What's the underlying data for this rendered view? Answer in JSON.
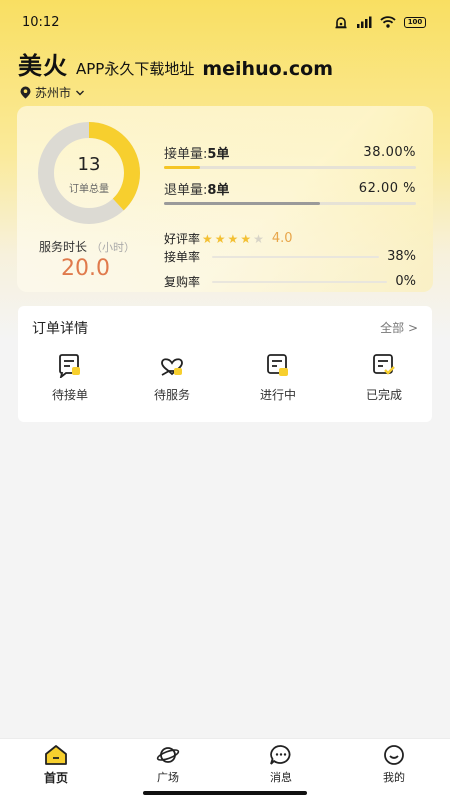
{
  "status_bar": {
    "time": "10:12",
    "battery": "100"
  },
  "header": {
    "brand": "美火",
    "slogan": "APP永久下载地址",
    "domain": "meihuo.com"
  },
  "location": {
    "city": "苏州市"
  },
  "stats": {
    "total_orders": "13",
    "total_orders_label": "订单总量",
    "donut_fill_fraction": 0.38,
    "service_duration_label": "服务时长",
    "service_duration_unit": "（小时）",
    "service_duration_value": "20.0",
    "accepted_label": "接单量:",
    "accepted_value": "5单",
    "accepted_pct": "38.00%",
    "accepted_fraction": 0.38,
    "returned_label": "退单量:",
    "returned_value": "8单",
    "returned_pct": "62.00 %",
    "returned_fraction": 0.62,
    "rating_label": "好评率",
    "rating_value": "4.0",
    "rating_stars": 4,
    "acceptance_rate_label": "接单率",
    "acceptance_rate_value": "38%",
    "repurchase_label": "复购率",
    "repurchase_value": "0%"
  },
  "orders": {
    "title": "订单详情",
    "all_label": "全部 >",
    "items": [
      {
        "label": "待接单",
        "icon": "pending-accept-icon"
      },
      {
        "label": "待服务",
        "icon": "pending-service-icon"
      },
      {
        "label": "进行中",
        "icon": "in-progress-icon"
      },
      {
        "label": "已完成",
        "icon": "completed-icon"
      }
    ]
  },
  "tabbar": {
    "items": [
      {
        "label": "首页",
        "icon": "home-icon",
        "active": true
      },
      {
        "label": "广场",
        "icon": "planet-icon",
        "active": false
      },
      {
        "label": "消息",
        "icon": "message-icon",
        "active": false
      },
      {
        "label": "我的",
        "icon": "profile-icon",
        "active": false
      }
    ]
  },
  "colors": {
    "accent": "#f7cf2e",
    "duration": "#e07a4c",
    "bar_gray": "#9a9a9a"
  }
}
